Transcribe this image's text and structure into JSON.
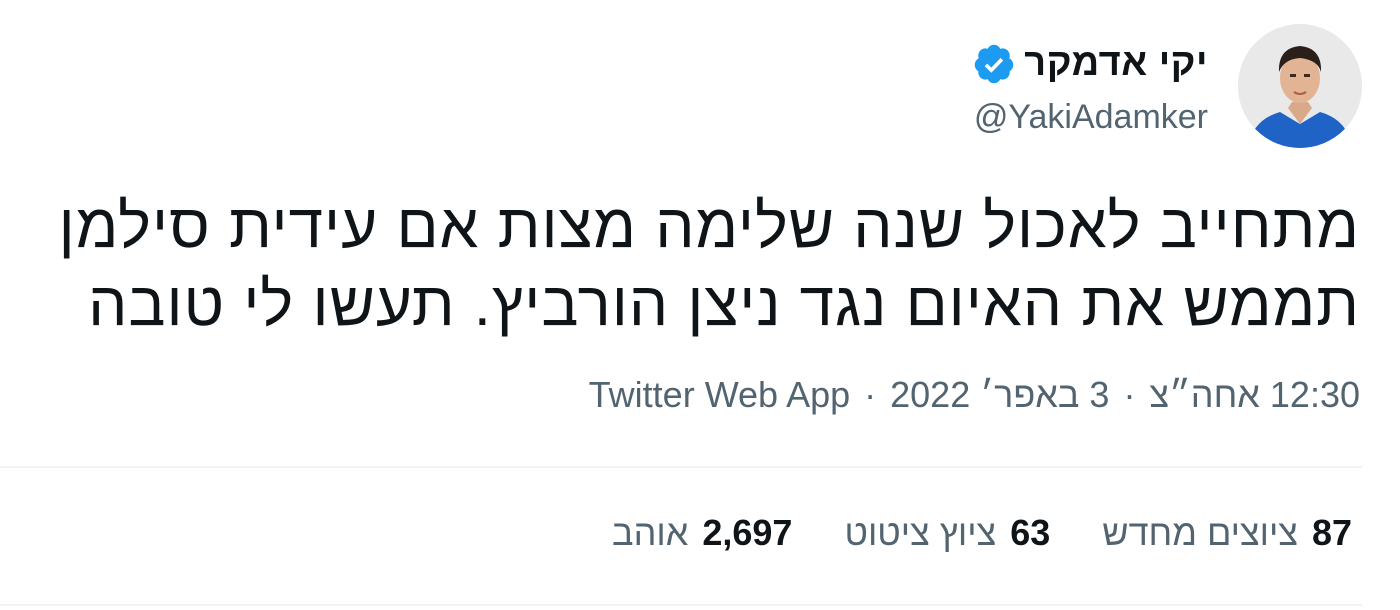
{
  "author": {
    "display_name": "יקי אדמקר",
    "handle": "@YakiAdamker",
    "verified": true
  },
  "tweet": {
    "text_line_1": "מתחייב לאכול שנה שלימה מצות אם עידית סילמן",
    "text_line_2": "תממש את האיום נגד ניצן הורביץ. תעשו לי טובה"
  },
  "meta": {
    "time": "12:30 אחה״צ",
    "date": "3 באפר׳ 2022",
    "source": "Twitter Web App",
    "separator": "·"
  },
  "stats": [
    {
      "count": "87",
      "label": "ציוצים מחדש"
    },
    {
      "count": "63",
      "label": "ציוץ ציטוט"
    },
    {
      "count": "2,697",
      "label": "אוהב"
    }
  ],
  "colors": {
    "verified_badge": "#1d9bf0",
    "text_primary": "#0f1419",
    "text_secondary": "#536471",
    "divider": "#eff3f4"
  }
}
